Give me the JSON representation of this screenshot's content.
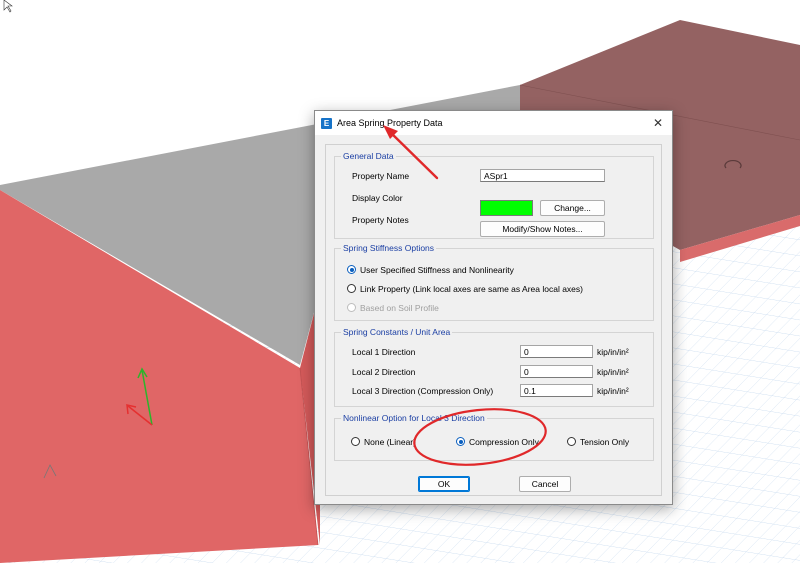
{
  "dialog": {
    "title": "Area Spring Property Data",
    "app_icon_letter": "E",
    "close_glyph": "✕"
  },
  "general_data": {
    "legend": "General Data",
    "property_name_label": "Property Name",
    "property_name_value": "ASpr1",
    "display_color_label": "Display Color",
    "display_color_value": "#00ff00",
    "change_button": "Change...",
    "property_notes_label": "Property Notes",
    "notes_button": "Modify/Show Notes..."
  },
  "stiffness_options": {
    "legend": "Spring Stiffness Options",
    "option_user": "User Specified Stiffness and Nonlinearity",
    "option_link": "Link Property (Link local axes are same as Area local axes)",
    "option_soil": "Based on Soil Profile",
    "selected": "user"
  },
  "spring_constants": {
    "legend": "Spring Constants / Unit Area",
    "rows": [
      {
        "label": "Local 1 Direction",
        "value": "0",
        "unit": "kip/in/in²"
      },
      {
        "label": "Local 2 Direction",
        "value": "0",
        "unit": "kip/in/in²"
      },
      {
        "label": "Local 3 Direction  (Compression Only)",
        "value": "0.1",
        "unit": "kip/in/in²"
      }
    ]
  },
  "nonlinear_option": {
    "legend": "Nonlinear Option for Local 3 Direction",
    "option_none": "None (Linear)",
    "option_compression": "Compression Only",
    "option_tension": "Tension Only",
    "selected": "compression"
  },
  "buttons": {
    "ok": "OK",
    "cancel": "Cancel"
  },
  "colors": {
    "accent": "#0078d7",
    "legend_text": "#1a3ea3",
    "annotation_red": "#e0282a",
    "box_front": "#e06666",
    "box_top": "#a7a7a7",
    "slab": "#9b6a6a"
  }
}
